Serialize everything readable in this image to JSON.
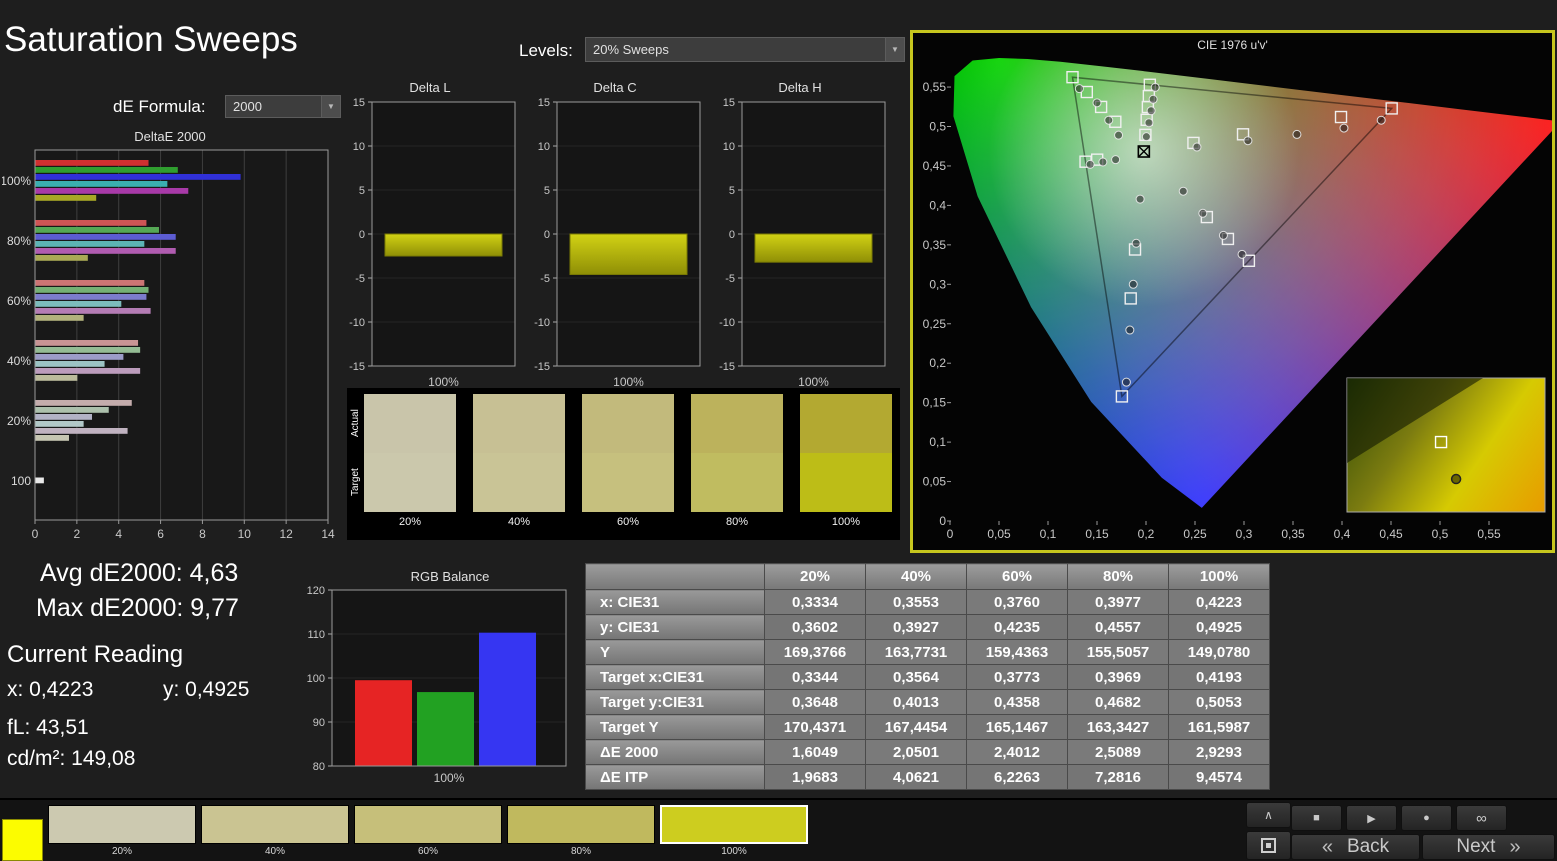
{
  "app": {
    "title": "Saturation Sweeps",
    "levels_label": "Levels:",
    "levels_value": "20% Sweeps",
    "de_formula_label": "dE Formula:",
    "de_formula_value": "2000"
  },
  "stats": {
    "avg_de2000": "Avg dE2000: 4,63",
    "max_de2000": "Max dE2000: 9,77",
    "current_reading_label": "Current Reading",
    "x_value": "x: 0,4223",
    "y_value": "y: 0,4925",
    "fl_value": "fL: 43,51",
    "cdm2_value": "cd/m²: 149,08"
  },
  "swatch_strip": {
    "actual_label": "Actual",
    "target_label": "Target",
    "items": [
      {
        "label": "20%",
        "actual": "#c9c5aa",
        "target": "#cbc8ac"
      },
      {
        "label": "40%",
        "actual": "#c7c094",
        "target": "#c9c496"
      },
      {
        "label": "60%",
        "actual": "#c2ba7c",
        "target": "#c6c07e"
      },
      {
        "label": "80%",
        "actual": "#bcb25c",
        "target": "#c0bc60"
      },
      {
        "label": "100%",
        "actual": "#b3a931",
        "target": "#bdbd17"
      }
    ]
  },
  "results_table": {
    "columns": [
      "20%",
      "40%",
      "60%",
      "80%",
      "100%"
    ],
    "rows": [
      {
        "label": "x: CIE31",
        "values": [
          "0,3334",
          "0,3553",
          "0,3760",
          "0,3977",
          "0,4223"
        ]
      },
      {
        "label": "y: CIE31",
        "values": [
          "0,3602",
          "0,3927",
          "0,4235",
          "0,4557",
          "0,4925"
        ]
      },
      {
        "label": "Y",
        "values": [
          "169,3766",
          "163,7731",
          "159,4363",
          "155,5057",
          "149,0780"
        ]
      },
      {
        "label": "Target x:CIE31",
        "values": [
          "0,3344",
          "0,3564",
          "0,3773",
          "0,3969",
          "0,4193"
        ]
      },
      {
        "label": "Target y:CIE31",
        "values": [
          "0,3648",
          "0,4013",
          "0,4358",
          "0,4682",
          "0,5053"
        ]
      },
      {
        "label": "Target Y",
        "values": [
          "170,4371",
          "167,4454",
          "165,1467",
          "163,3427",
          "161,5987"
        ]
      },
      {
        "label": "ΔE 2000",
        "values": [
          "1,6049",
          "2,0501",
          "2,4012",
          "2,5089",
          "2,9293"
        ]
      },
      {
        "label": "ΔE ITP",
        "values": [
          "1,9683",
          "4,0621",
          "6,2263",
          "7,2816",
          "9,4574"
        ]
      }
    ]
  },
  "bottom_bar": {
    "current_patch_color": "#fcfc00",
    "levels": [
      {
        "label": "20%",
        "color": "#ccc9b0",
        "selected": false
      },
      {
        "label": "40%",
        "color": "#cac492",
        "selected": false
      },
      {
        "label": "60%",
        "color": "#c6bf7a",
        "selected": false
      },
      {
        "label": "80%",
        "color": "#c0b95e",
        "selected": false
      },
      {
        "label": "100%",
        "color": "#cdcd1f",
        "selected": true
      }
    ],
    "transport": [
      {
        "name": "stop-button",
        "icon": "stop-icon"
      },
      {
        "name": "play-button",
        "icon": "play-icon"
      },
      {
        "name": "record-button",
        "icon": "record-icon"
      },
      {
        "name": "loop-button",
        "icon": "infinity-icon"
      }
    ],
    "back_chevron": "«",
    "back_label": "Back",
    "next_label": "Next",
    "next_chevron": "»"
  },
  "chart_data": [
    {
      "id": "deltae2000",
      "type": "bar",
      "orientation": "horizontal",
      "title": "DeltaE 2000",
      "xlim": [
        0,
        14
      ],
      "x_ticks": [
        0,
        2,
        4,
        6,
        8,
        10,
        12,
        14
      ],
      "groups": [
        {
          "label": "100%",
          "values": [
            5.4,
            6.8,
            9.8,
            6.3,
            7.3,
            2.9
          ],
          "colors": [
            "#d03030",
            "#2f9e2f",
            "#3030d8",
            "#3ab0b0",
            "#a83aa8",
            "#a8a826"
          ]
        },
        {
          "label": "80%",
          "values": [
            5.3,
            5.9,
            6.7,
            5.2,
            6.7,
            2.5
          ],
          "colors": [
            "#cf5555",
            "#55a855",
            "#5c5cd2",
            "#5cb4b4",
            "#b05cb0",
            "#aaaa55"
          ]
        },
        {
          "label": "60%",
          "values": [
            5.2,
            5.4,
            5.3,
            4.1,
            5.5,
            2.3
          ],
          "colors": [
            "#cc7474",
            "#74b074",
            "#7c7ccc",
            "#7cbcbc",
            "#b47cb4",
            "#b2b27c"
          ]
        },
        {
          "label": "40%",
          "values": [
            4.9,
            5.0,
            4.2,
            3.3,
            5.0,
            2.0
          ],
          "colors": [
            "#c89494",
            "#94bc94",
            "#9c9cc8",
            "#9cc4c4",
            "#bc9cbc",
            "#bcbc9c"
          ]
        },
        {
          "label": "20%",
          "values": [
            4.6,
            3.5,
            2.7,
            2.3,
            4.4,
            1.6
          ],
          "colors": [
            "#c4acac",
            "#acc0ac",
            "#b2b2c6",
            "#b2c8c8",
            "#c0b2c0",
            "#c6c6b2"
          ]
        },
        {
          "label": "100",
          "values": [
            0.4
          ],
          "colors": [
            "#e8e8e8"
          ]
        }
      ]
    },
    {
      "id": "delta_l",
      "type": "bar",
      "title": "Delta L",
      "categories": [
        "100%"
      ],
      "values": [
        -2.5
      ],
      "ylim": [
        -15,
        15
      ],
      "y_ticks": [
        15,
        10,
        5,
        0,
        -5,
        -10,
        -15
      ],
      "xlabel": "100%",
      "bar_color": "#c6c60e"
    },
    {
      "id": "delta_c",
      "type": "bar",
      "title": "Delta C",
      "categories": [
        "100%"
      ],
      "values": [
        -4.6
      ],
      "ylim": [
        -15,
        15
      ],
      "y_ticks": [
        15,
        10,
        5,
        0,
        -5,
        -10,
        -15
      ],
      "xlabel": "100%",
      "bar_color": "#c6c60e"
    },
    {
      "id": "delta_h",
      "type": "bar",
      "title": "Delta H",
      "categories": [
        "100%"
      ],
      "values": [
        -3.2
      ],
      "ylim": [
        -15,
        15
      ],
      "y_ticks": [
        15,
        10,
        5,
        0,
        -5,
        -10,
        -15
      ],
      "xlabel": "100%",
      "bar_color": "#c6c60e"
    },
    {
      "id": "rgb_balance",
      "type": "bar",
      "title": "RGB Balance",
      "categories": [
        "Red",
        "Green",
        "Blue"
      ],
      "values": [
        99.5,
        96.8,
        110.3
      ],
      "colors": [
        "#e62424",
        "#22a122",
        "#3636f2"
      ],
      "ylim": [
        80,
        120
      ],
      "y_ticks": [
        120,
        110,
        100,
        90,
        80
      ],
      "xlabel": "100%"
    },
    {
      "id": "cie_1976",
      "type": "scatter",
      "title": "CIE 1976 u'v'",
      "xlim": [
        0,
        0.62
      ],
      "ylim": [
        0,
        0.62
      ],
      "tick_values": [
        0,
        0.05,
        0.1,
        0.15,
        0.2,
        0.25,
        0.3,
        0.35,
        0.4,
        0.45,
        0.5,
        0.55
      ],
      "tick_labels": [
        "0",
        "0,05",
        "0,1",
        "0,15",
        "0,2",
        "0,25",
        "0,3",
        "0,35",
        "0,4",
        "0,45",
        "0,5",
        "0,55"
      ],
      "white_point": [
        0.1978,
        0.4683
      ],
      "gamut_triangle": [
        [
          0.4507,
          0.5229
        ],
        [
          0.125,
          0.5625
        ],
        [
          0.1754,
          0.1579
        ]
      ],
      "targets": [
        [
          0.125,
          0.5625
        ],
        [
          0.1396,
          0.5437
        ],
        [
          0.1542,
          0.5248
        ],
        [
          0.1687,
          0.506
        ],
        [
          0.2039,
          0.5529
        ],
        [
          0.2029,
          0.5385
        ],
        [
          0.2019,
          0.5247
        ],
        [
          0.2007,
          0.5085
        ],
        [
          0.1994,
          0.4894
        ],
        [
          0.4507,
          0.5229
        ],
        [
          0.399,
          0.512
        ],
        [
          0.299,
          0.4901
        ],
        [
          0.2484,
          0.4792
        ],
        [
          0.305,
          0.3298
        ],
        [
          0.2836,
          0.3575
        ],
        [
          0.2621,
          0.3852
        ],
        [
          0.1383,
          0.4554
        ],
        [
          0.1502,
          0.458
        ],
        [
          0.1754,
          0.1579
        ],
        [
          0.1844,
          0.2821
        ],
        [
          0.1888,
          0.3441
        ]
      ],
      "measurements": [
        [
          0.2004,
          0.4871
        ],
        [
          0.203,
          0.5048
        ],
        [
          0.2052,
          0.52
        ],
        [
          0.2073,
          0.5345
        ],
        [
          0.2094,
          0.5496
        ],
        [
          0.132,
          0.548
        ],
        [
          0.15,
          0.53
        ],
        [
          0.162,
          0.508
        ],
        [
          0.172,
          0.489
        ],
        [
          0.252,
          0.474
        ],
        [
          0.304,
          0.482
        ],
        [
          0.354,
          0.49
        ],
        [
          0.402,
          0.498
        ],
        [
          0.44,
          0.508
        ],
        [
          0.298,
          0.338
        ],
        [
          0.279,
          0.362
        ],
        [
          0.258,
          0.39
        ],
        [
          0.238,
          0.418
        ],
        [
          0.143,
          0.452
        ],
        [
          0.156,
          0.455
        ],
        [
          0.169,
          0.458
        ],
        [
          0.18,
          0.176
        ],
        [
          0.1835,
          0.242
        ],
        [
          0.187,
          0.3
        ],
        [
          0.19,
          0.352
        ],
        [
          0.194,
          0.408
        ]
      ],
      "inset": {
        "target_marker": [
          0.475,
          0.478
        ],
        "measure_marker": [
          0.551,
          0.754
        ]
      }
    }
  ]
}
